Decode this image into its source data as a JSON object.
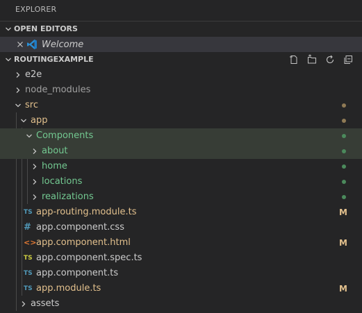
{
  "header": {
    "title": "EXPLORER"
  },
  "open_editors": {
    "title": "OPEN EDITORS",
    "items": [
      {
        "label": "Welcome",
        "icon": "vscode-logo-icon"
      }
    ]
  },
  "project": {
    "title": "ROUTINGEXAMPLE",
    "actions": [
      "new-file-icon",
      "new-folder-icon",
      "refresh-icon",
      "collapse-all-icon"
    ]
  },
  "tree": {
    "e2e": "e2e",
    "node_modules": "node_modules",
    "src": "src",
    "app": "app",
    "components": "Components",
    "about": "about",
    "home": "home",
    "locations": "locations",
    "realizations": "realizations",
    "routing_module": "app-routing.module.ts",
    "component_css": "app.component.css",
    "component_html": "app.component.html",
    "component_spec": "app.component.spec.ts",
    "component_ts": "app.component.ts",
    "app_module": "app.module.ts",
    "assets": "assets"
  },
  "badges": {
    "ts": "TS",
    "css": "#",
    "html": "<>",
    "modified": "M"
  },
  "colors": {
    "background": "#252526",
    "selection": "#37373d",
    "modified": "#e2c08d",
    "untracked": "#73c991",
    "typescript": "#519aba",
    "html": "#e37933",
    "spec": "#cbcb41"
  }
}
